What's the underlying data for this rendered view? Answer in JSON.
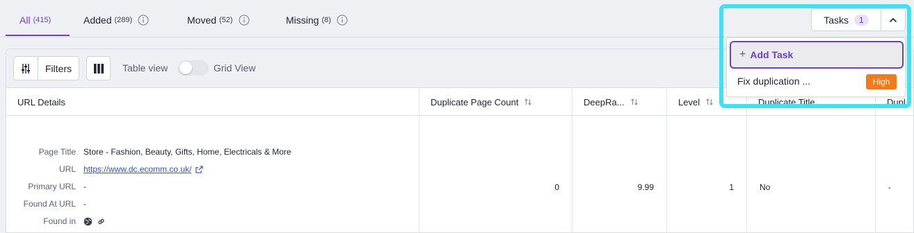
{
  "tabs": [
    {
      "label": "All",
      "count": "(415)"
    },
    {
      "label": "Added",
      "count": "(289)"
    },
    {
      "label": "Moved",
      "count": "(52)"
    },
    {
      "label": "Missing",
      "count": "(8)"
    }
  ],
  "toolbar": {
    "filters_label": "Filters",
    "table_view_label": "Table view",
    "grid_view_label": "Grid View"
  },
  "table": {
    "headers": [
      "URL Details",
      "Duplicate Page Count",
      "DeepRa...",
      "Level",
      "Duplicate Title",
      "Dupl"
    ],
    "row": {
      "details": [
        {
          "label": "Page Title",
          "value": "Store - Fashion, Beauty, Gifts, Home, Electricals & More"
        },
        {
          "label": "URL",
          "value": "https://www.dc.ecomm.co.uk/"
        },
        {
          "label": "Primary URL",
          "value": "-"
        },
        {
          "label": "Found At URL",
          "value": "-"
        },
        {
          "label": "Found in",
          "value": ""
        }
      ],
      "duplicate_page_count": "0",
      "deeprank": "9.99",
      "level": "1",
      "duplicate_title": "No",
      "dupl": "-"
    }
  },
  "tasks": {
    "label": "Tasks",
    "count": "1",
    "add_label": "Add Task",
    "items": [
      {
        "name": "Fix duplication ...",
        "priority": "High"
      }
    ]
  },
  "colors": {
    "accent": "#6b3fd4",
    "highlight": "#3fe2f5",
    "priority_high": "#f07a1c",
    "link": "#2a55d8"
  }
}
